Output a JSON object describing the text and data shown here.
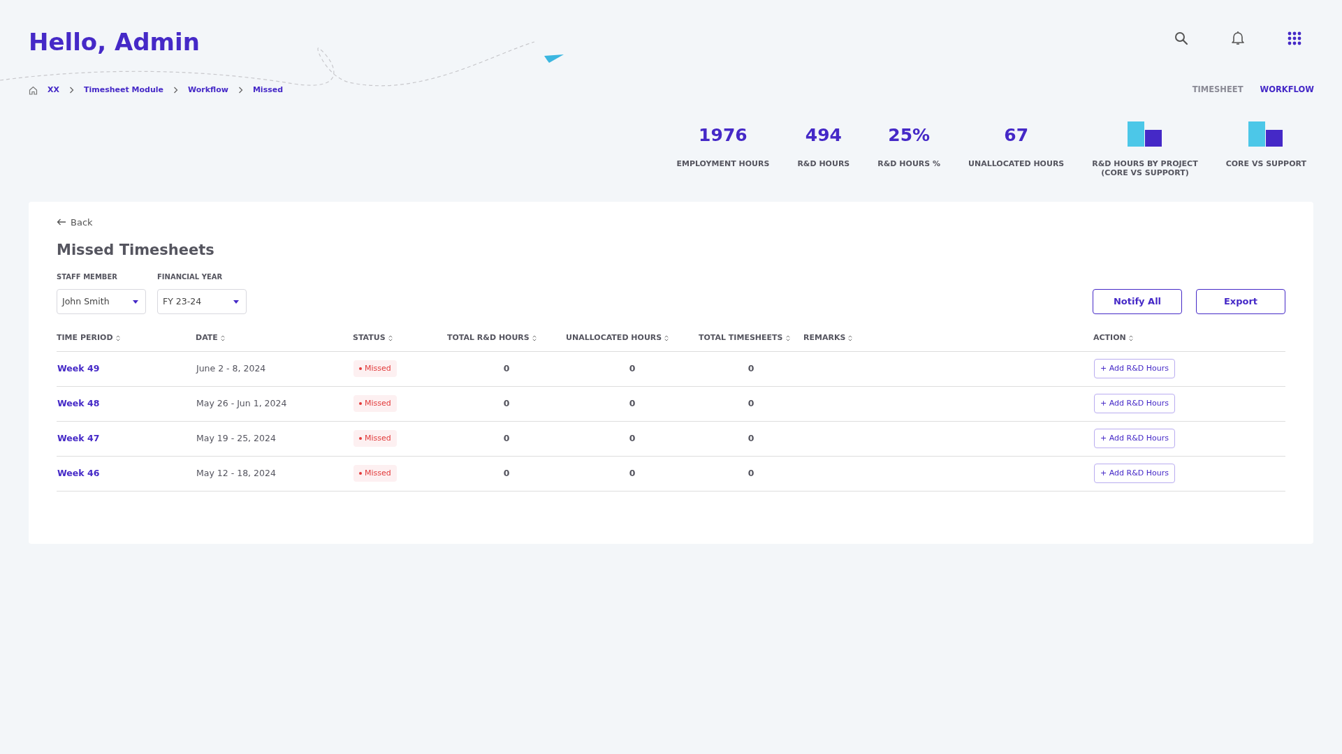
{
  "header": {
    "greeting": "Hello, Admin"
  },
  "breadcrumb": [
    {
      "label": "XX"
    },
    {
      "label": "Timesheet Module"
    },
    {
      "label": "Workflow"
    },
    {
      "label": "Missed"
    }
  ],
  "tabs": [
    {
      "label": "TIMESHEET",
      "selected": false
    },
    {
      "label": "WORKFLOW",
      "selected": true
    }
  ],
  "stats": [
    {
      "kind": "number",
      "value": "1976",
      "label": "EMPLOYMENT HOURS"
    },
    {
      "kind": "number",
      "value": "494",
      "label": "R&D HOURS"
    },
    {
      "kind": "number",
      "value": "25%",
      "label": "R&D HOURS %"
    },
    {
      "kind": "number",
      "value": "67",
      "label": "UNALLOCATED HOURS"
    },
    {
      "kind": "chart",
      "label": "R&D HOURS  BY PROJECT\n(CORE VS SUPPORT)"
    },
    {
      "kind": "chart",
      "label": "CORE VS SUPPORT"
    }
  ],
  "panel": {
    "back": "Back",
    "title": "Missed Timesheets",
    "filters": [
      {
        "label": "STAFF MEMBER",
        "value": "John Smith"
      },
      {
        "label": "FINANCIAL YEAR",
        "value": "FY 23-24"
      }
    ],
    "buttons": [
      "Notify All",
      "Export"
    ]
  },
  "table": {
    "columns": [
      "TIME PERIOD",
      "DATE",
      "STATUS",
      "TOTAL R&D HOURS",
      "UNALLOCATED HOURS",
      "TOTAL TIMESHEETS",
      "REMARKS",
      "ACTION"
    ],
    "rows": [
      {
        "period": "Week 49",
        "date": "June 2 - 8, 2024",
        "status": "Missed",
        "total_rd": "0",
        "unallocated": "0",
        "timesheets": "0",
        "action": "+ Add R&D Hours"
      },
      {
        "period": "Week 48",
        "date": "May 26 - Jun 1, 2024",
        "status": "Missed",
        "total_rd": "0",
        "unallocated": "0",
        "timesheets": "0",
        "action": "+ Add R&D Hours"
      },
      {
        "period": "Week 47",
        "date": "May 19 - 25, 2024",
        "status": "Missed",
        "total_rd": "0",
        "unallocated": "0",
        "timesheets": "0",
        "action": "+ Add R&D Hours"
      },
      {
        "period": "Week 46",
        "date": "May 12 - 18, 2024",
        "status": "Missed",
        "total_rd": "0",
        "unallocated": "0",
        "timesheets": "0",
        "action": "+ Add R&D Hours"
      }
    ]
  }
}
